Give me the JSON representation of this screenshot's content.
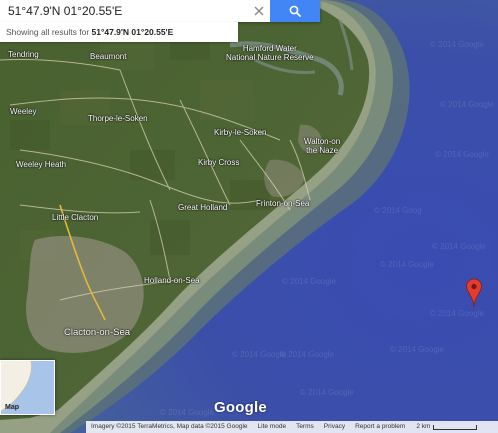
{
  "search": {
    "value": "51°47.9'N 01°20.55'E"
  },
  "results": {
    "prefix": "Showing all results for",
    "query": "51°47.9'N 01°20.55'E"
  },
  "places": {
    "tendring": "Tendring",
    "beaumont": "Beaumont",
    "hamford_1": "Hamford Water",
    "hamford_2": "National Nature Reserve",
    "weeley": "Weeley",
    "thorpe": "Thorpe-le-Soken",
    "kirby_soken": "Kirby-le-Soken",
    "walton_1": "Walton-on",
    "walton_2": "the Naze",
    "weeley_heath": "Weeley Heath",
    "kirby_cross": "Kirby Cross",
    "great_holland": "Great Holland",
    "frinton": "Frinton-on-Sea",
    "little_clacton": "Little Clacton",
    "holland": "Holland-on-Sea",
    "clacton": "Clacton-on-Sea"
  },
  "watermarks": [
    "© 2014 Google",
    "© 2014 Google",
    "© 2014 Goog",
    "© 2014 Google",
    "© 2014 Google",
    "© 2014 Google",
    "© 2014 Google",
    "© 2014 Google",
    "© 2014 Google",
    "© 2014 Google",
    "© 2014 Google",
    "© 2014 Google",
    "© 2014 Google"
  ],
  "minimap": {
    "label": "Map"
  },
  "logo": "Google",
  "footer": {
    "imagery": "Imagery ©2015 TerraMetrics, Map data ©2015 Google",
    "lite": "Lite mode",
    "terms": "Terms",
    "privacy": "Privacy",
    "report": "Report a problem",
    "scale": "2 km"
  },
  "colors": {
    "sea": "#3a4eb0",
    "land": "#4b6133",
    "shallow": "#8a9779",
    "search_button": "#4285f4",
    "pin": "#e03c2f"
  },
  "icons": {
    "clear": "close-icon",
    "search": "search-icon",
    "pin": "map-pin-icon"
  }
}
